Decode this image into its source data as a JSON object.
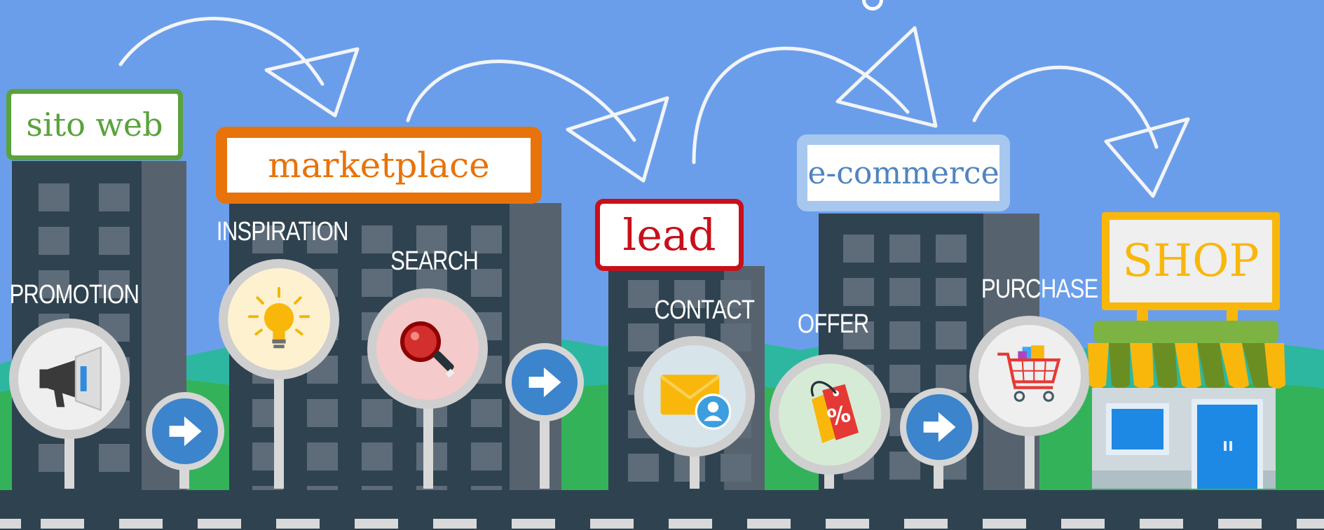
{
  "signs": {
    "sito_web": "sito web",
    "marketplace": "marketplace",
    "lead": "lead",
    "ecommerce": "e-commerce",
    "shop": "SHOP"
  },
  "stages": {
    "promotion": "PROMOTION",
    "inspiration": "INSPIRATION",
    "search": "SEARCH",
    "contact": "CONTACT",
    "offer": "OFFER",
    "purchase": "PURCHASE"
  },
  "colors": {
    "sky": "#6b9eea",
    "road": "#2f4250",
    "green": "#5aa23c",
    "orange": "#e8730a",
    "red": "#c8101a",
    "light_blue": "#a7c7ef",
    "yellow": "#f9b70b",
    "arrow_blue": "#3c84cc"
  },
  "icons": [
    "megaphone-icon",
    "lightbulb-icon",
    "magnifier-icon",
    "mail-contact-icon",
    "discount-tag-icon",
    "shopping-cart-icon",
    "arrow-right-icon",
    "store-icon"
  ]
}
